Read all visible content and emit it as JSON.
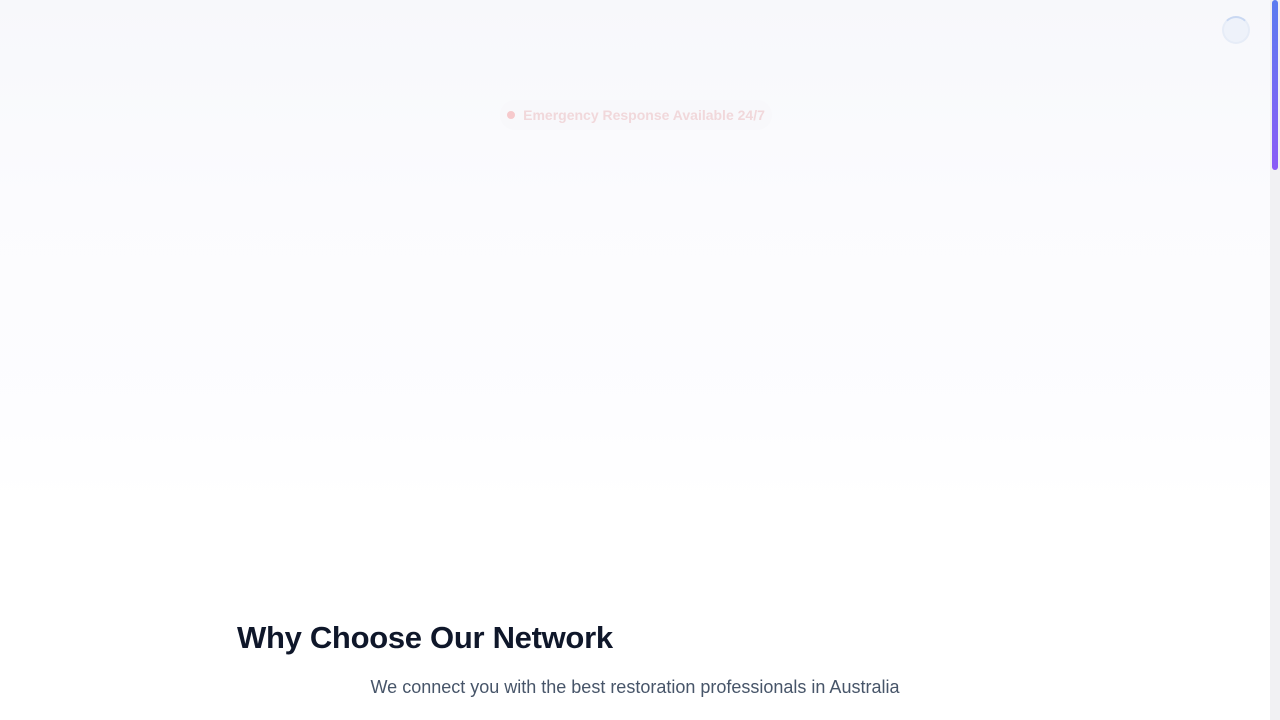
{
  "page": {
    "background_color": "#ffffff"
  },
  "header": {
    "loading_indicator": "spinner-icon"
  },
  "hero": {
    "badge": {
      "text": "Emergency Response Available 24/7",
      "dot_color": "#f6c9cc",
      "icon": "status-dot-icon"
    }
  },
  "features_section": {
    "title": "Why Choose Our Network",
    "subtitle": "We connect you with the best restoration professionals in Australia",
    "title_color": "#0f172a",
    "subtitle_color": "#475569"
  },
  "scrollbar": {
    "thumb_colors": [
      "#5b7cf0",
      "#8b5cf6"
    ]
  }
}
